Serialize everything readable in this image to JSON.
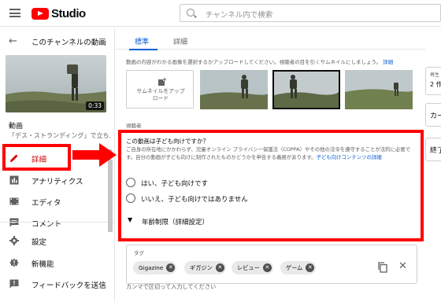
{
  "header": {
    "brand": "Studio",
    "search_placeholder": "チャンネル内で検索"
  },
  "sidebar": {
    "back_label": "このチャンネルの動画",
    "video_duration": "0:33",
    "video_heading": "動画",
    "video_title": "「デス・ストランディング」で立ち…",
    "items": [
      {
        "label": "詳細",
        "icon": "pencil-icon",
        "active": true
      },
      {
        "label": "アナリティクス",
        "icon": "analytics-icon"
      },
      {
        "label": "エディタ",
        "icon": "film-icon"
      },
      {
        "label": "コメント",
        "icon": "comment-icon"
      },
      {
        "label": "設定",
        "icon": "gear-icon"
      },
      {
        "label": "新機能",
        "icon": "badge-icon"
      },
      {
        "label": "フィードバックを送信",
        "icon": "feedback-icon"
      }
    ]
  },
  "tabs": [
    {
      "label": "標準",
      "active": true
    },
    {
      "label": "詳細",
      "active": false
    }
  ],
  "thumbnail": {
    "description": "動画の内容がわかる画像を選択するかアップロードしてください。視聴者の目を引くサムネイルにしましょう。",
    "link": "詳細",
    "upload_label": "サムネイルをアップロード"
  },
  "audience": {
    "section_label": "視聴者",
    "question": "この動画は子ども向けですか？",
    "description": "ご自身の所在地にかかわらず、児童オンライン プライバシー保護法（COPPA）やその他の法令を遵守することが法的に必要です。自分の動画が子ども向けに制作されたものかどうかを申告する義務があります。",
    "link": "子ども向けコンテンツの詳細",
    "option_yes": "はい、子ども向けです",
    "option_no": "いいえ、子ども向けではありません",
    "age_restriction": "年齢制限（詳細設定）"
  },
  "tags": {
    "label": "タグ",
    "items": [
      "Gigazine",
      "ギガジン",
      "レビュー",
      "ゲーム"
    ],
    "hint": "カンマで区切って入力してください"
  },
  "right_panel": {
    "box1_label": "再生",
    "box1_value": "2 作",
    "box2_value": "カー",
    "box3_value": "終了"
  },
  "colors": {
    "accent": "#065fd4",
    "annotation_red": "#ff0000",
    "brand_red": "#ff0000"
  }
}
